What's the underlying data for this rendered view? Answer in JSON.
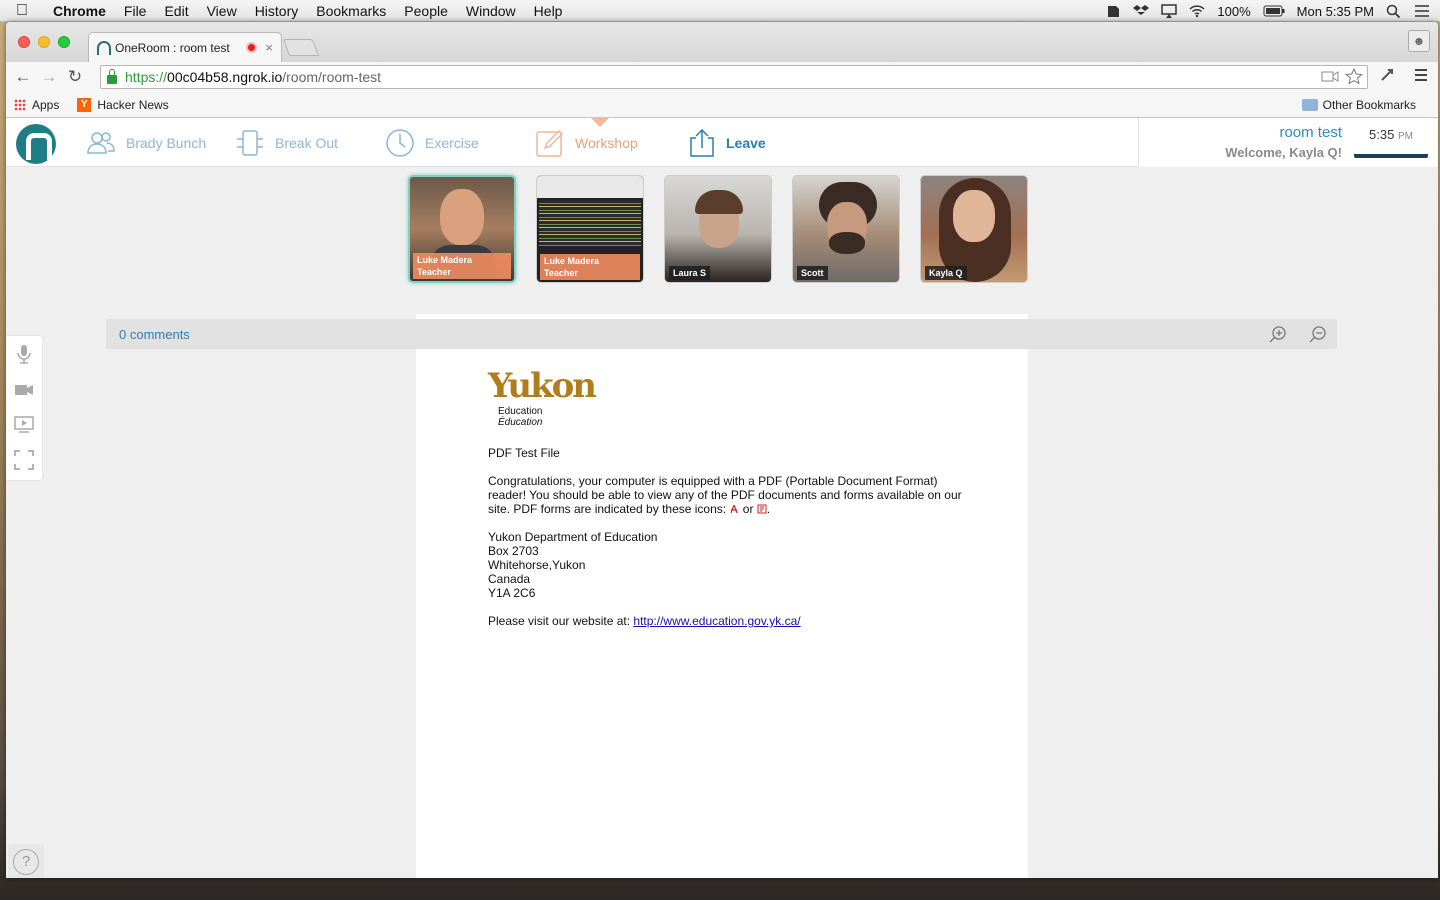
{
  "menubar": {
    "app": "Chrome",
    "items": [
      "File",
      "Edit",
      "View",
      "History",
      "Bookmarks",
      "People",
      "Window",
      "Help"
    ],
    "battery": "100%",
    "clock": "Mon 5:35 PM"
  },
  "browser": {
    "tab_title": "OneRoom : room test",
    "tab_close": "×",
    "url_scheme": "https://",
    "url_host": "00c04b58.ngrok.io",
    "url_path": "/room/room-test",
    "bookmarks": {
      "apps": "Apps",
      "hacker_news": "Hacker News",
      "hacker_news_icon": "Y",
      "other": "Other Bookmarks"
    }
  },
  "nav": {
    "items": [
      {
        "label": "Brady Bunch",
        "icon": "people-icon"
      },
      {
        "label": "Break Out",
        "icon": "breakout-icon"
      },
      {
        "label": "Exercise",
        "icon": "clock-icon"
      },
      {
        "label": "Workshop",
        "icon": "pencil-icon"
      },
      {
        "label": "Leave",
        "icon": "share-icon"
      }
    ],
    "active": "Workshop"
  },
  "user": {
    "room": "room test",
    "welcome": "Welcome, Kayla Q!",
    "time": "5:35",
    "ampm": "PM"
  },
  "participants": [
    {
      "name": "Luke Madera",
      "role": "Teacher"
    },
    {
      "name": "Luke Madera",
      "role": "Teacher"
    },
    {
      "name": "Laura S",
      "role": ""
    },
    {
      "name": "Scott",
      "role": ""
    },
    {
      "name": "Kayla Q",
      "role": ""
    }
  ],
  "comments": {
    "label": "0 comments"
  },
  "help": "?",
  "document": {
    "logo": "Yukon",
    "logo_sub1": "Education",
    "logo_sub2": "Éducation",
    "title": "PDF Test File",
    "body_1": "Congratulations, your computer is equipped with a PDF (Portable Document Format) reader!  You should be able to view any of the PDF documents and forms available on our site.  PDF forms are indicated by these icons: ",
    "body_or": " or ",
    "body_end": ".",
    "address": [
      "Yukon Department of Education",
      "Box 2703",
      "Whitehorse,Yukon",
      "Canada",
      "Y1A 2C6"
    ],
    "visit": "Please visit our website at:  ",
    "link": "http://www.education.gov.yk.ca/"
  },
  "colors": {
    "brand": "#1f7d86",
    "nav_link": "#8cb8d6",
    "active": "#e8a27a",
    "accent": "#2a7fae"
  }
}
